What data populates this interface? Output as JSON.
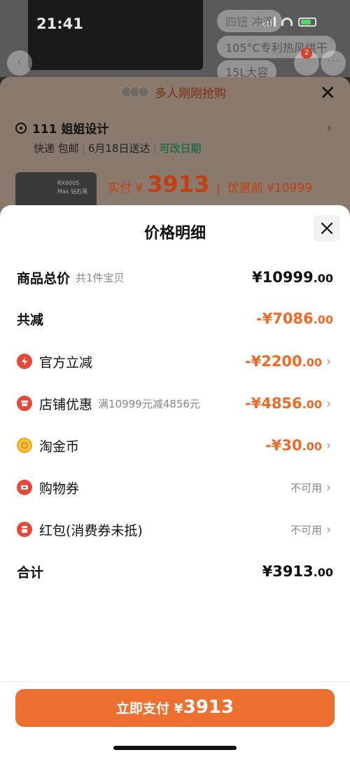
{
  "status_bar": {
    "time": "21:41"
  },
  "background": {
    "pill_1": "四钮 冲滴",
    "pill_2": "105°C专利热风烘干",
    "pill_3": "15L大容",
    "cart_badge": "2",
    "banner": "多人刚刚抢购",
    "address_name": "111 姐姐设计",
    "ship_method": "快递 包邮",
    "ship_date": "6月18日送达",
    "ship_change": "可改日期",
    "thumb_text": "RX600S Max 钻石黑",
    "pay_label": "实付 ¥",
    "pay_amount": "3913",
    "orig_label": "优惠前 ¥10999"
  },
  "modal": {
    "title": "价格明细",
    "rows": [
      {
        "label": "商品总价",
        "sub": "共1件宝贝",
        "amount": "¥10999",
        "decimal": ".00"
      },
      {
        "label": "共减",
        "amount": "-¥7086",
        "decimal": ".00"
      },
      {
        "label": "官方立减",
        "amount": "-¥2200",
        "decimal": ".00",
        "icon": "lightning-icon"
      },
      {
        "label": "店铺优惠",
        "sub": "满10999元减4856元",
        "amount": "-¥4856",
        "decimal": ".00",
        "icon": "shop-icon"
      },
      {
        "label": "淘金币",
        "amount": "-¥30",
        "decimal": ".00",
        "icon": "coin-icon"
      },
      {
        "label": "购物券",
        "status": "不可用",
        "icon": "ticket-icon"
      },
      {
        "label": "红包(消费券未抵)",
        "status": "不可用",
        "icon": "red-packet-icon"
      },
      {
        "label": "合计",
        "amount": "¥3913",
        "decimal": ".00"
      }
    ],
    "pay_button": {
      "label": "立即支付 ¥",
      "amount": "3913"
    }
  },
  "colors": {
    "accent": "#ee7030",
    "discount": "#ef6a25",
    "icon_red": "#e8473a"
  }
}
